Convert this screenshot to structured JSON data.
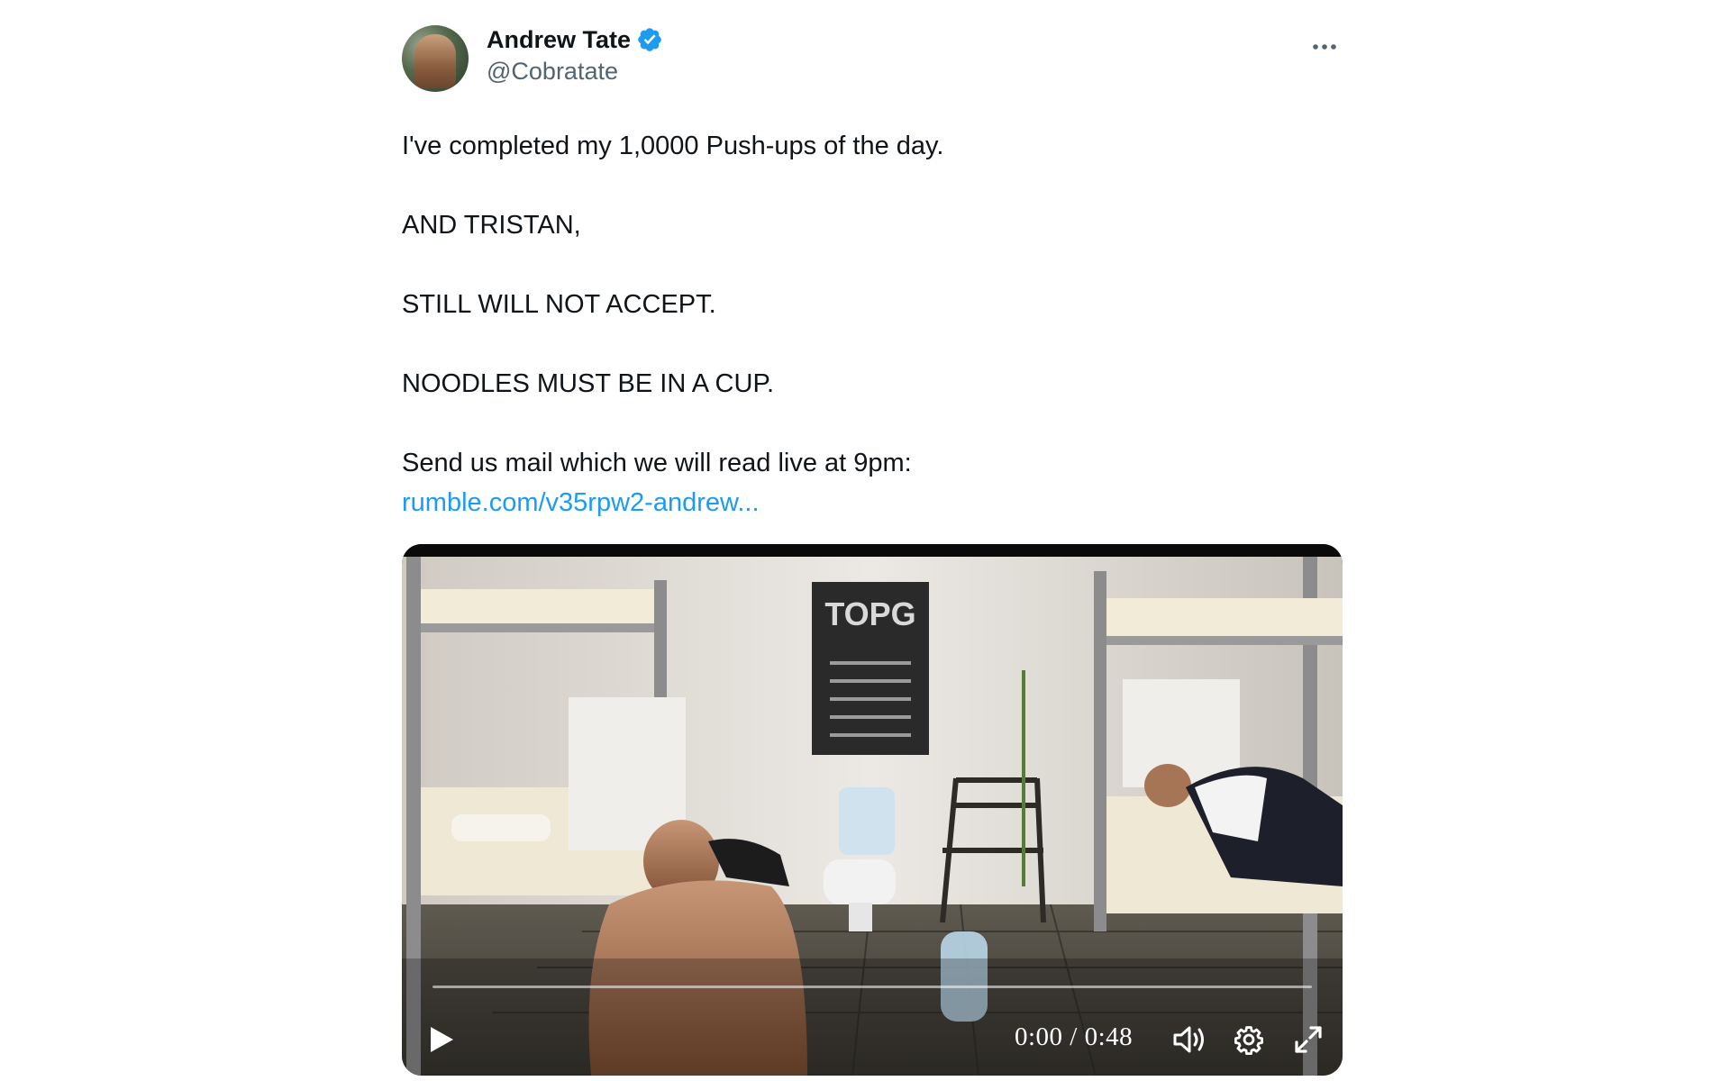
{
  "author": {
    "display_name": "Andrew Tate",
    "handle": "@Cobratate",
    "verified": true,
    "avatar_icon": "avatar-photo"
  },
  "more_icon": "more-horizontal-icon",
  "tweet": {
    "paragraphs": [
      "I've completed my 1,0000 Push-ups of the day.",
      "AND TRISTAN,",
      "STILL WILL NOT ACCEPT.",
      "NOODLES MUST BE IN A CUP."
    ],
    "final_line": "Send us mail which we will read live at 9pm:",
    "link_text": "rumble.com/v35rpw2-andrew..."
  },
  "video": {
    "time_display": "0:00 / 0:48",
    "progress": 0,
    "controls": {
      "play_icon": "play-icon",
      "volume_icon": "volume-icon",
      "settings_icon": "gear-icon",
      "fullscreen_icon": "fullscreen-icon"
    },
    "poster_text": "TOPG"
  },
  "colors": {
    "link": "#1d9bf0",
    "verified": "#1d9bf0",
    "secondary_text": "#536471",
    "primary_text": "#0f1419"
  }
}
